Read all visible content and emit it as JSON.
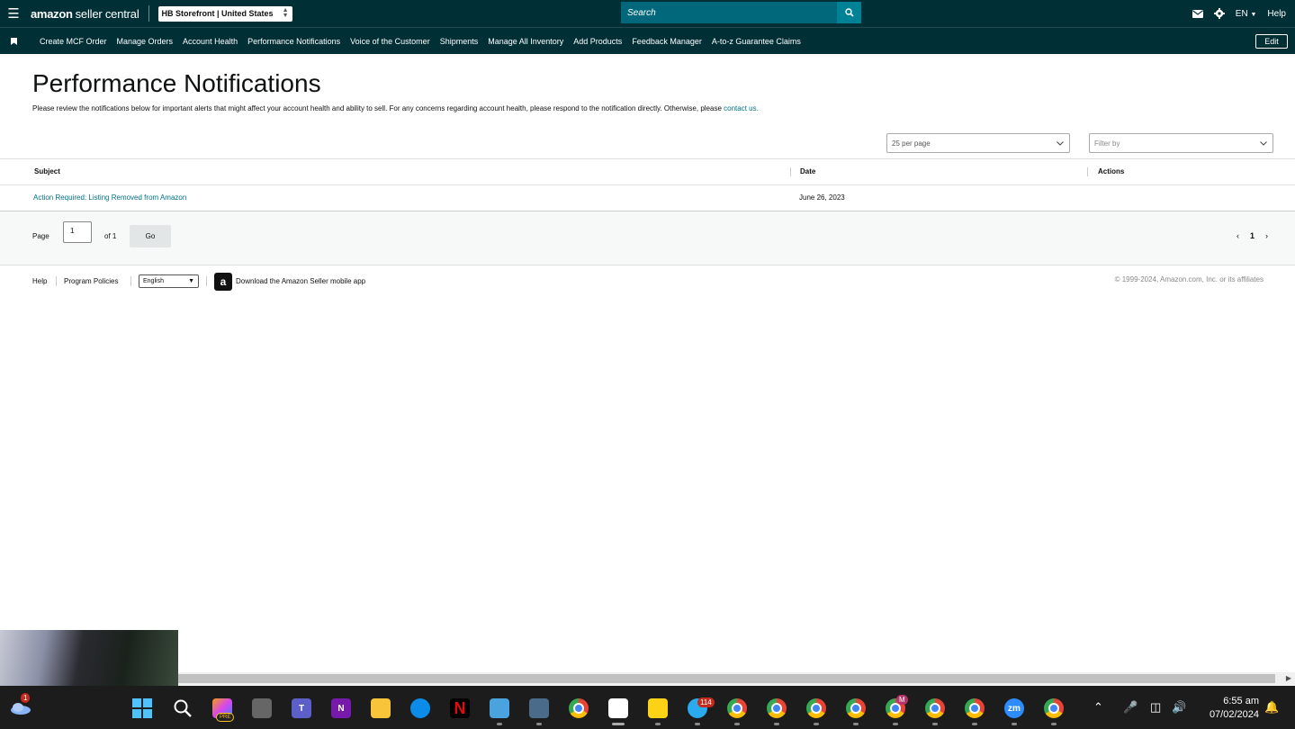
{
  "header": {
    "logo_brand": "amazon",
    "logo_product": "seller central",
    "store": "HB Storefront | United States",
    "search_placeholder": "Search",
    "language": "EN",
    "help": "Help"
  },
  "nav": {
    "items": [
      "Create MCF Order",
      "Manage Orders",
      "Account Health",
      "Performance Notifications",
      "Voice of the Customer",
      "Shipments",
      "Manage All Inventory",
      "Add Products",
      "Feedback Manager",
      "A-to-z Guarantee Claims"
    ],
    "edit_label": "Edit"
  },
  "page": {
    "title": "Performance Notifications",
    "intro_text": "Please review the notifications below for important alerts that might affect your account health and ability to sell. For any concerns regarding account health, please respond to the notification directly. Otherwise, please",
    "intro_link": "contact us."
  },
  "filters": {
    "per_page": "25 per page",
    "filter_placeholder": "Filter by"
  },
  "table": {
    "columns": [
      "Subject",
      "Date",
      "Actions"
    ],
    "rows": [
      {
        "subject": "Action Required: Listing Removed from Amazon",
        "date": "June 26, 2023",
        "actions": ""
      }
    ]
  },
  "pagination": {
    "page_label": "Page",
    "page_value": "1",
    "of_label": "of 1",
    "go_label": "Go",
    "current_page": "1"
  },
  "footer": {
    "help": "Help",
    "program_policies": "Program Policies",
    "language": "English",
    "app_text": "Download the Amazon Seller mobile app",
    "copyright": "© 1999-2024, Amazon.com, Inc. or its affiliates"
  },
  "taskbar": {
    "weather_badge": "1",
    "telegram_badge": "114",
    "copilot_badge": "PRE",
    "zoom_label": "zm",
    "gmail_letter": "M",
    "time": "6:55 am",
    "date": "07/02/2024"
  },
  "colors": {
    "header_bg": "#002f36",
    "search_bg": "#00687a",
    "link": "#007185"
  }
}
